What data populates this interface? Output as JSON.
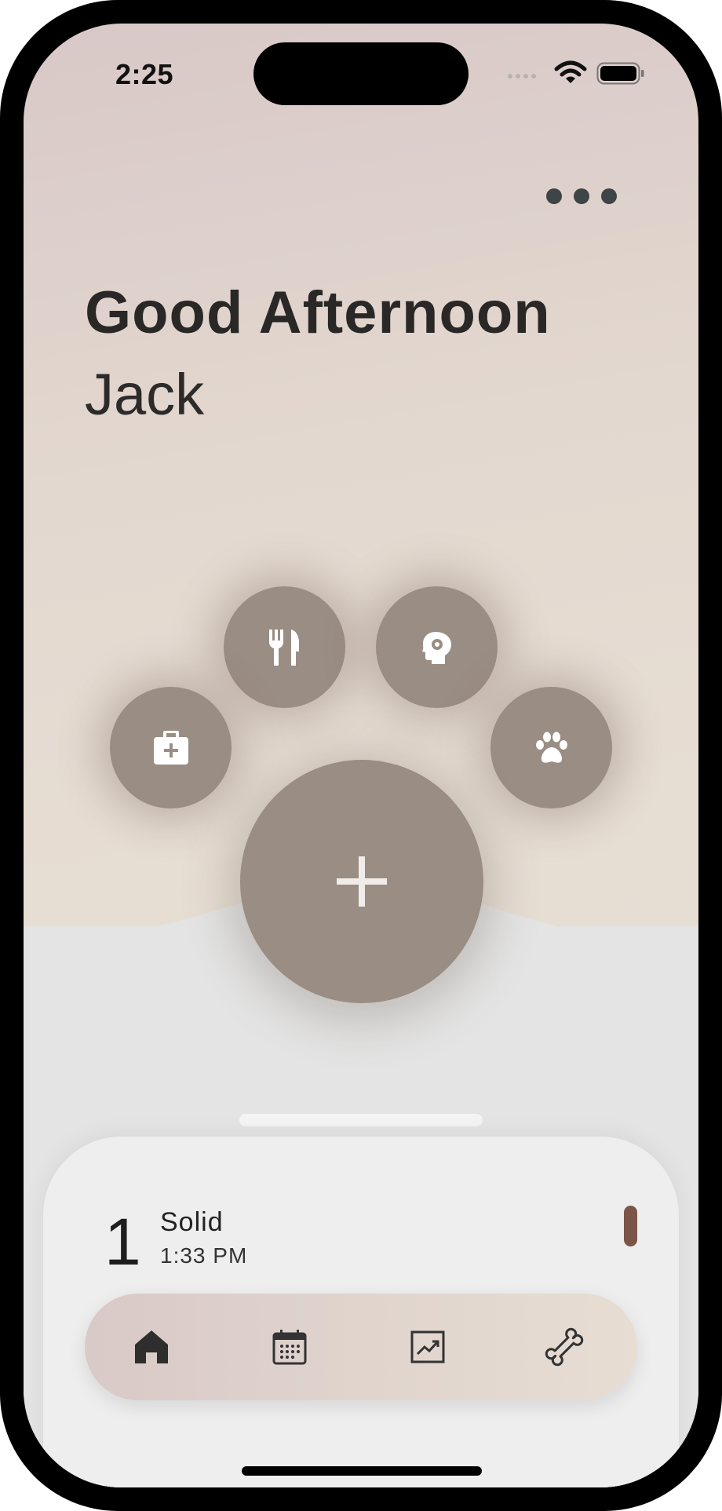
{
  "status_bar": {
    "time": "2:25",
    "icons": [
      "cellular-signal-icon",
      "wifi-icon",
      "battery-icon"
    ]
  },
  "header": {
    "more_icon": "ellipsis-icon",
    "greeting": "Good Afternoon",
    "name": "Jack"
  },
  "quick_actions": [
    {
      "name": "food",
      "icon": "fork-knife-icon"
    },
    {
      "name": "mind",
      "icon": "head-gear-icon"
    },
    {
      "name": "medical",
      "icon": "first-aid-kit-icon"
    },
    {
      "name": "pet",
      "icon": "paw-icon"
    }
  ],
  "add_button": {
    "icon": "plus-icon"
  },
  "latest_entry": {
    "count": "1",
    "type": "Solid",
    "time": "1:33 PM",
    "marker_color": "#7a5548"
  },
  "tab_bar": [
    {
      "name": "home",
      "icon": "home-icon",
      "active": true
    },
    {
      "name": "calendar",
      "icon": "calendar-icon",
      "active": false
    },
    {
      "name": "stats",
      "icon": "chart-icon",
      "active": false
    },
    {
      "name": "bone",
      "icon": "bone-icon",
      "active": false
    }
  ],
  "colors": {
    "accent": "#9a8d84",
    "text": "#292827",
    "background_top": "#d8c8c7",
    "background_mid": "#e6ddd3",
    "lower_background": "#e4e4e4",
    "sheet": "#eeeeee"
  }
}
